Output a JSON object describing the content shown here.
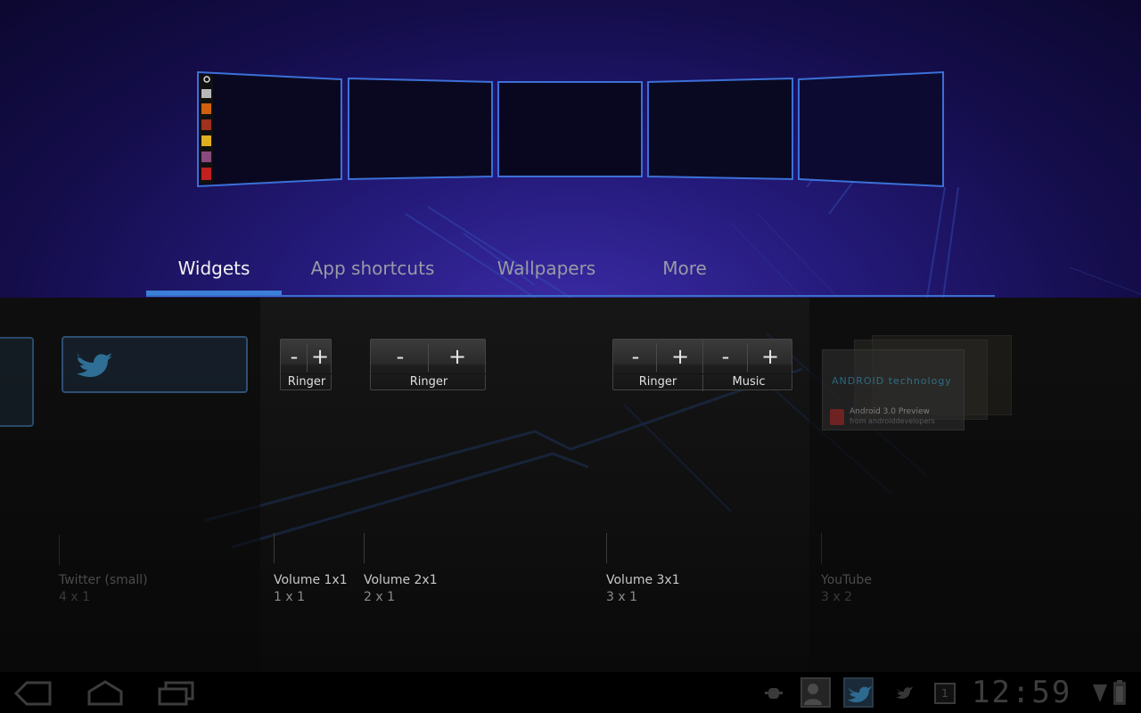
{
  "tabs": [
    {
      "label": "Widgets",
      "active": true
    },
    {
      "label": "App shortcuts",
      "active": false
    },
    {
      "label": "Wallpapers",
      "active": false
    },
    {
      "label": "More",
      "active": false
    }
  ],
  "widgets": [
    {
      "name": "Twitter (small)",
      "size": "4 x 1"
    },
    {
      "name": "Volume 1x1",
      "size": "1 x 1",
      "buttons": [
        "-",
        "+"
      ],
      "captions": [
        "Ringer"
      ]
    },
    {
      "name": "Volume 2x1",
      "size": "2 x 1",
      "buttons": [
        "-",
        "+"
      ],
      "captions": [
        "Ringer"
      ]
    },
    {
      "name": "Volume 3x1",
      "size": "3 x 1",
      "buttons": [
        "-",
        "+",
        "-",
        "+"
      ],
      "captions": [
        "Ringer",
        "Music"
      ]
    },
    {
      "name": "YouTube",
      "size": "3 x 2",
      "preview_logo": "ANDROID technology",
      "preview_title": "Android 3.0 Preview",
      "preview_subtitle": "from androiddevelopers"
    }
  ],
  "system_bar": {
    "clock": "12:59",
    "calendar_day": "1",
    "icons": [
      "back-icon",
      "home-icon",
      "recent-apps-icon",
      "usb-debug-icon",
      "contact-icon",
      "twitter-icon",
      "twitter-small-icon",
      "calendar-icon",
      "signal-icon",
      "battery-icon"
    ]
  },
  "colors": {
    "accent": "#3a7fd8",
    "screen_outline": "#3c70d8",
    "top_background": "#241a7a"
  }
}
